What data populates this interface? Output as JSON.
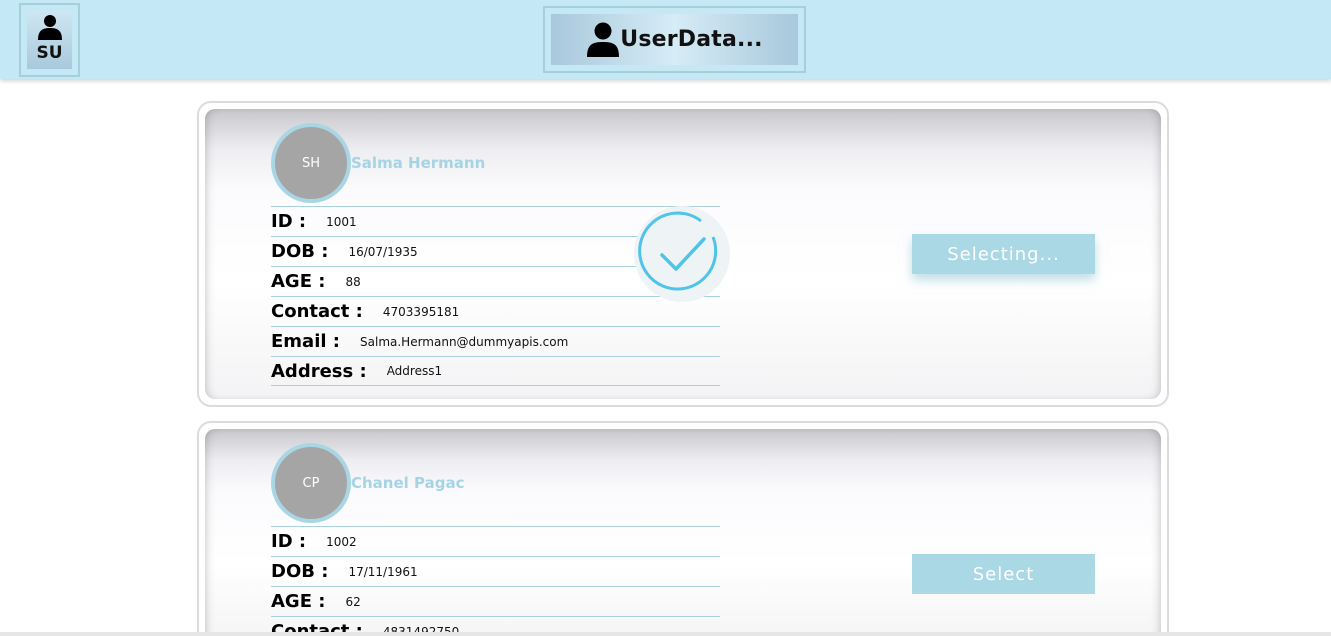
{
  "header": {
    "user_badge": "SU",
    "title": "UserData...",
    "icon": "user-icon",
    "colors": {
      "background": "#c4e8f6",
      "border": "#a5cfd9"
    }
  },
  "users": [
    {
      "initials": "SH",
      "name": "Salma Hermann",
      "fields": [
        {
          "label": "ID :",
          "value": "1001"
        },
        {
          "label": "DOB :",
          "value": "16/07/1935"
        },
        {
          "label": "AGE :",
          "value": "88"
        },
        {
          "label": "Contact :",
          "value": "4703395181"
        },
        {
          "label": "Email :",
          "value": "Salma.Hermann@dummyapis.com"
        },
        {
          "label": "Address :",
          "value": "Address1"
        }
      ],
      "button_label": "Selecting...",
      "selected": true
    },
    {
      "initials": "CP",
      "name": "Chanel Pagac",
      "fields": [
        {
          "label": "ID :",
          "value": "1002"
        },
        {
          "label": "DOB :",
          "value": "17/11/1961"
        },
        {
          "label": "AGE :",
          "value": "62"
        },
        {
          "label": "Contact :",
          "value": "4831492750"
        }
      ],
      "button_label": "Select",
      "selected": false
    }
  ],
  "colors": {
    "accent": "#aad8e5",
    "name_text": "#a5d4e4",
    "avatar": "#a5a5a5",
    "check": "#4fc3e8"
  }
}
